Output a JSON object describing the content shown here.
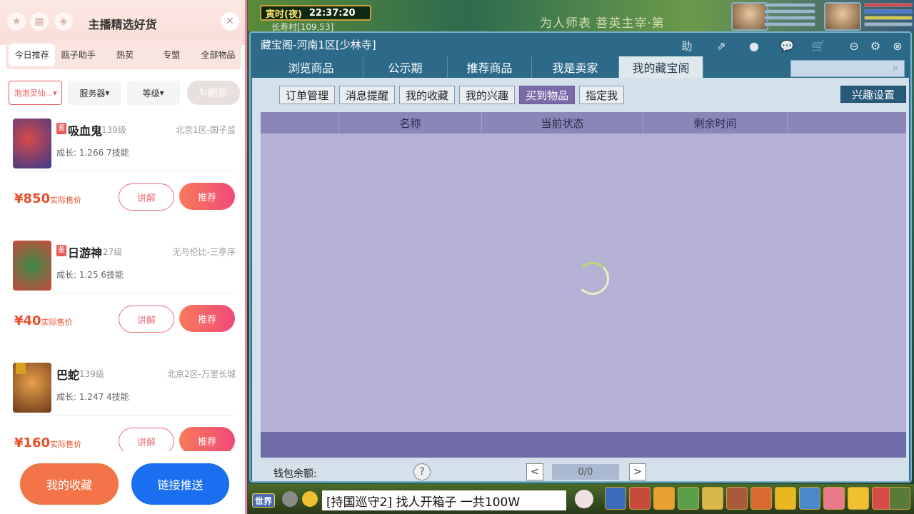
{
  "colors": {
    "accent_red": "#e8502a",
    "push_blue": "#1a6ef0",
    "window_bg": "#2d6a8a",
    "table_bg": "#b4b1d4",
    "active_subtab": "#7a6aa8"
  },
  "game_hud": {
    "time_label": "寅时(夜)",
    "clock": "22:37:20",
    "village": "长寿村[109,53]",
    "announce": "为人师表    菩英主宰·第"
  },
  "left_panel": {
    "title": "主播精选好货",
    "tabs": [
      "今日推荐",
      "瓯子助手",
      "热荬",
      "专盟",
      "全部物品"
    ],
    "filters": {
      "pet": "泡泡灵仙...",
      "server": "服务器",
      "level": "等级",
      "refresh": "刷新"
    },
    "items": [
      {
        "tag": "鉴",
        "name": "吸血鬼",
        "level": "139级",
        "server": "北京1区-国子监",
        "growth": "成长: 1.266 7技能",
        "price": "¥850",
        "price_label": "实际售价",
        "explain": "讲解",
        "recommend": "推荐"
      },
      {
        "tag": "鉴",
        "name": "日游神",
        "level": "27级",
        "server": "无与伦比-三亭序",
        "growth": "成长: 1.25 6技能",
        "price": "¥40",
        "price_label": "实际售价",
        "explain": "讲解",
        "recommend": "推荐"
      },
      {
        "tag": "",
        "name": "巴蛇",
        "level": "139级",
        "server": "北京2区-万里长城",
        "growth": "成长: 1.247 4技能",
        "price": "¥160",
        "price_label": "实际售价",
        "explain": "讲解",
        "recommend": "推荐"
      }
    ],
    "bottom": {
      "favorites": "我的收藏",
      "push": "链接推送"
    }
  },
  "window": {
    "title": "藏宝阁-河南1区[少林寺]",
    "icons": [
      "help-icon",
      "share-icon",
      "record-icon",
      "chat-icon",
      "cart-icon",
      "minimize-icon",
      "settings-icon",
      "close-icon"
    ],
    "help_label": "助",
    "tabs": [
      "浏览商品",
      "公示期",
      "推荐商品",
      "我是卖家",
      "我的藏宝阁"
    ],
    "subtabs": [
      "订单管理",
      "消息提醒",
      "我的收藏",
      "我的兴趣",
      "买到物品",
      "指定我"
    ],
    "interest_settings": "兴趣设置",
    "columns": [
      "名称",
      "当前状态",
      "剩余时间"
    ],
    "wallet_label": "钱包余额:",
    "help": "?",
    "pager": "0/0",
    "prev": "<",
    "next": ">"
  },
  "chat": {
    "channel": "世界",
    "message": "[持国巡守2] 找人开箱子    一共100W"
  }
}
